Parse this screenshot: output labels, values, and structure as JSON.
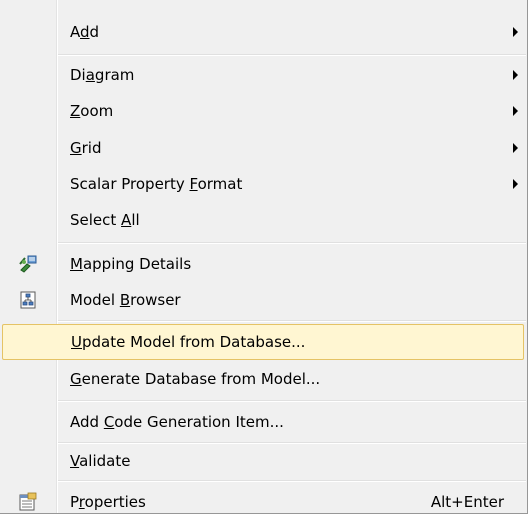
{
  "menu": {
    "items": [
      {
        "before": "A",
        "key": "d",
        "after": "d",
        "submenu": true
      },
      {
        "before": "Di",
        "key": "a",
        "after": "gram",
        "submenu": true
      },
      {
        "before": "",
        "key": "Z",
        "after": "oom",
        "submenu": true
      },
      {
        "before": "",
        "key": "G",
        "after": "rid",
        "submenu": true
      },
      {
        "before": "Scalar Property ",
        "key": "F",
        "after": "ormat",
        "submenu": true
      },
      {
        "before": "Select ",
        "key": "A",
        "after": "ll",
        "submenu": false
      },
      {
        "before": "",
        "key": "M",
        "after": "apping Details",
        "icon": "mapping-details-icon"
      },
      {
        "before": "Model ",
        "key": "B",
        "after": "rowser",
        "icon": "model-browser-icon"
      },
      {
        "before": "",
        "key": "U",
        "after": "pdate Model from Database...",
        "highlighted": true
      },
      {
        "before": "",
        "key": "G",
        "after": "enerate Database from Model..."
      },
      {
        "before": "Add ",
        "key": "C",
        "after": "ode Generation Item..."
      },
      {
        "before": "",
        "key": "V",
        "after": "alidate"
      },
      {
        "before": "P",
        "key": "r",
        "after": "operties",
        "shortcut": "Alt+Enter",
        "icon": "properties-icon"
      }
    ]
  },
  "colors": {
    "menu_background": "#f0f0f0",
    "highlight_background": "#fff6d2",
    "highlight_border": "#e5c365"
  }
}
